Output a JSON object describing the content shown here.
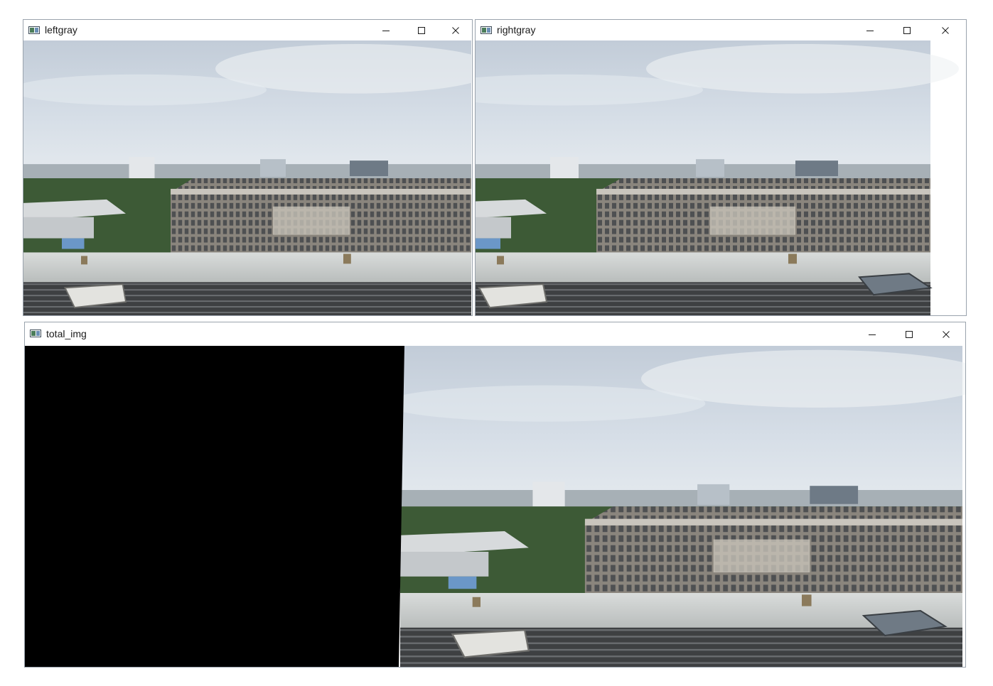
{
  "windows": {
    "left": {
      "title": "leftgray"
    },
    "right": {
      "title": "rightgray"
    },
    "total": {
      "title": "total_img"
    }
  },
  "icons": {
    "app": "opencv-window-icon",
    "minimize": "minimize-icon",
    "maximize": "maximize-icon",
    "close": "close-icon"
  },
  "colors": {
    "sky_top": "#c9d3de",
    "sky_bottom": "#dde5ec",
    "building": "#7e7a73",
    "trees": "#3d5a36",
    "ledge": "#cfd2d0",
    "roof": "#4a4c4e",
    "black_region": "#000000"
  }
}
